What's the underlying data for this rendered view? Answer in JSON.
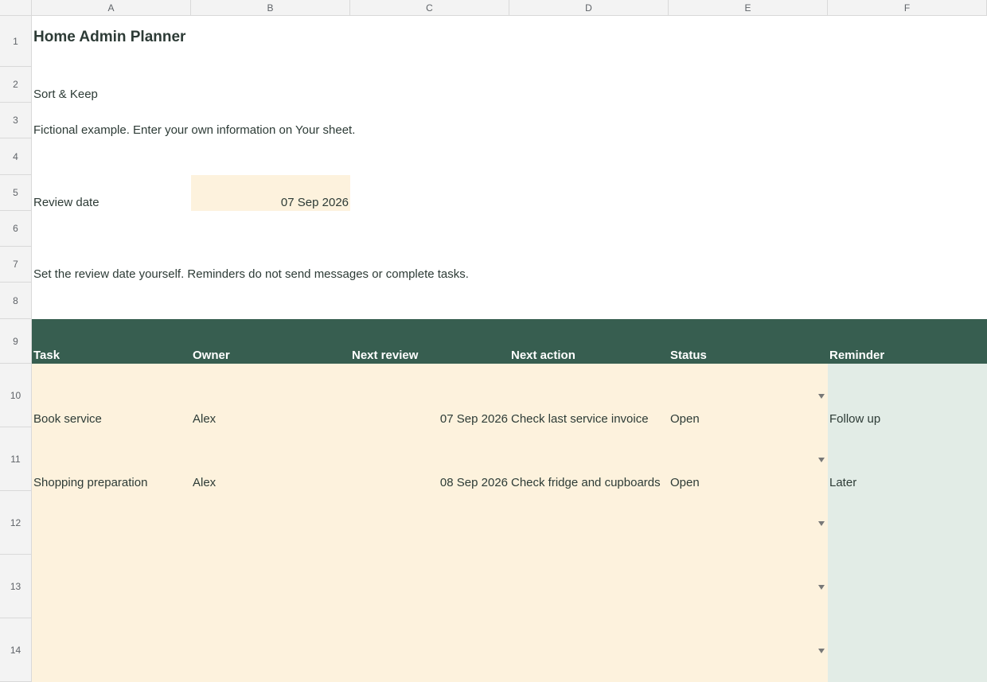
{
  "columns": [
    "A",
    "B",
    "C",
    "D",
    "E",
    "F"
  ],
  "rows": [
    "1",
    "2",
    "3",
    "4",
    "5",
    "6",
    "7",
    "8",
    "9",
    "10",
    "11",
    "12",
    "13",
    "14"
  ],
  "title": "Home Admin Planner",
  "subtitle": "Sort & Keep",
  "note": "Fictional example. Enter your own information on Your sheet.",
  "review": {
    "label": "Review date",
    "value": "07 Sep 2026"
  },
  "instruction": "Set the review date yourself. Reminders do not send messages or complete tasks.",
  "table": {
    "headers": [
      "Task",
      "Owner",
      "Next review",
      "Next action",
      "Status",
      "Reminder"
    ],
    "rows": [
      {
        "task": "Book service",
        "owner": "Alex",
        "next_review": "07 Sep 2026",
        "next_action": "Check last service invoice",
        "status": "Open",
        "reminder": "Follow up"
      },
      {
        "task": "Shopping preparation",
        "owner": "Alex",
        "next_review": "08 Sep 2026",
        "next_action": "Check fridge and cupboards",
        "status": "Open",
        "reminder": "Later"
      }
    ]
  },
  "colors": {
    "header": "#375e50",
    "input": "#fdf2dd",
    "reminder": "#e2ece6",
    "text": "#2d3b36"
  }
}
